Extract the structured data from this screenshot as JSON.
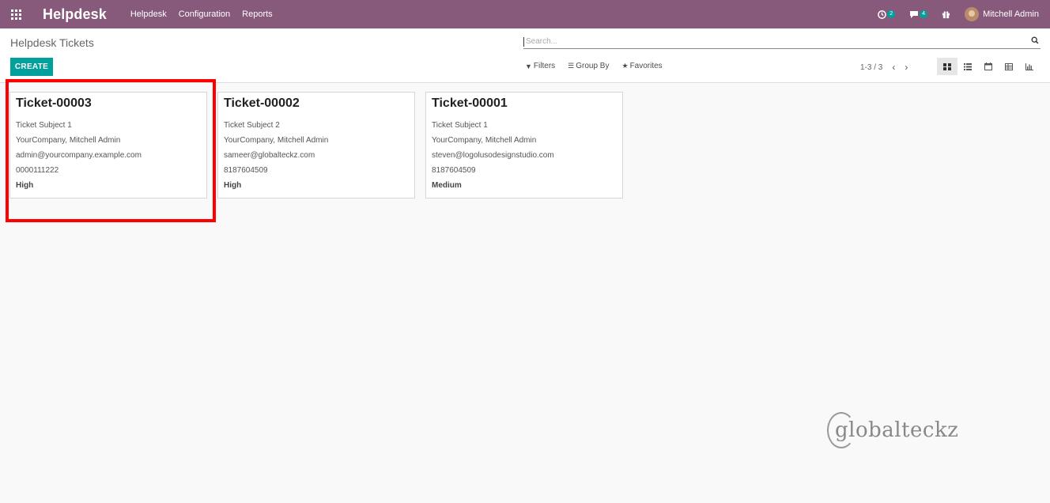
{
  "navbar": {
    "brand": "Helpdesk",
    "menu": [
      "Helpdesk",
      "Configuration",
      "Reports"
    ],
    "activity_count": "2",
    "message_count": "4",
    "user_name": "Mitchell Admin"
  },
  "control_panel": {
    "title": "Helpdesk Tickets",
    "create_label": "CREATE",
    "search_placeholder": "Search...",
    "filters_label": "Filters",
    "group_by_label": "Group By",
    "favorites_label": "Favorites",
    "pager": "1-3 / 3"
  },
  "tickets": [
    {
      "title": "Ticket-00003",
      "subject": "Ticket Subject 1",
      "partner": "YourCompany, Mitchell Admin",
      "email": "admin@yourcompany.example.com",
      "phone": "0000111222",
      "priority": "High"
    },
    {
      "title": "Ticket-00002",
      "subject": "Ticket Subject 2",
      "partner": "YourCompany, Mitchell Admin",
      "email": "sameer@globalteckz.com",
      "phone": "8187604509",
      "priority": "High"
    },
    {
      "title": "Ticket-00001",
      "subject": "Ticket Subject 1",
      "partner": "YourCompany, Mitchell Admin",
      "email": "steven@logolusodesignstudio.com",
      "phone": "8187604509",
      "priority": "Medium"
    }
  ],
  "watermark": "globalteckz",
  "colors": {
    "navbar": "#875a7b",
    "primary": "#00a09d",
    "highlight": "#ff0000"
  }
}
